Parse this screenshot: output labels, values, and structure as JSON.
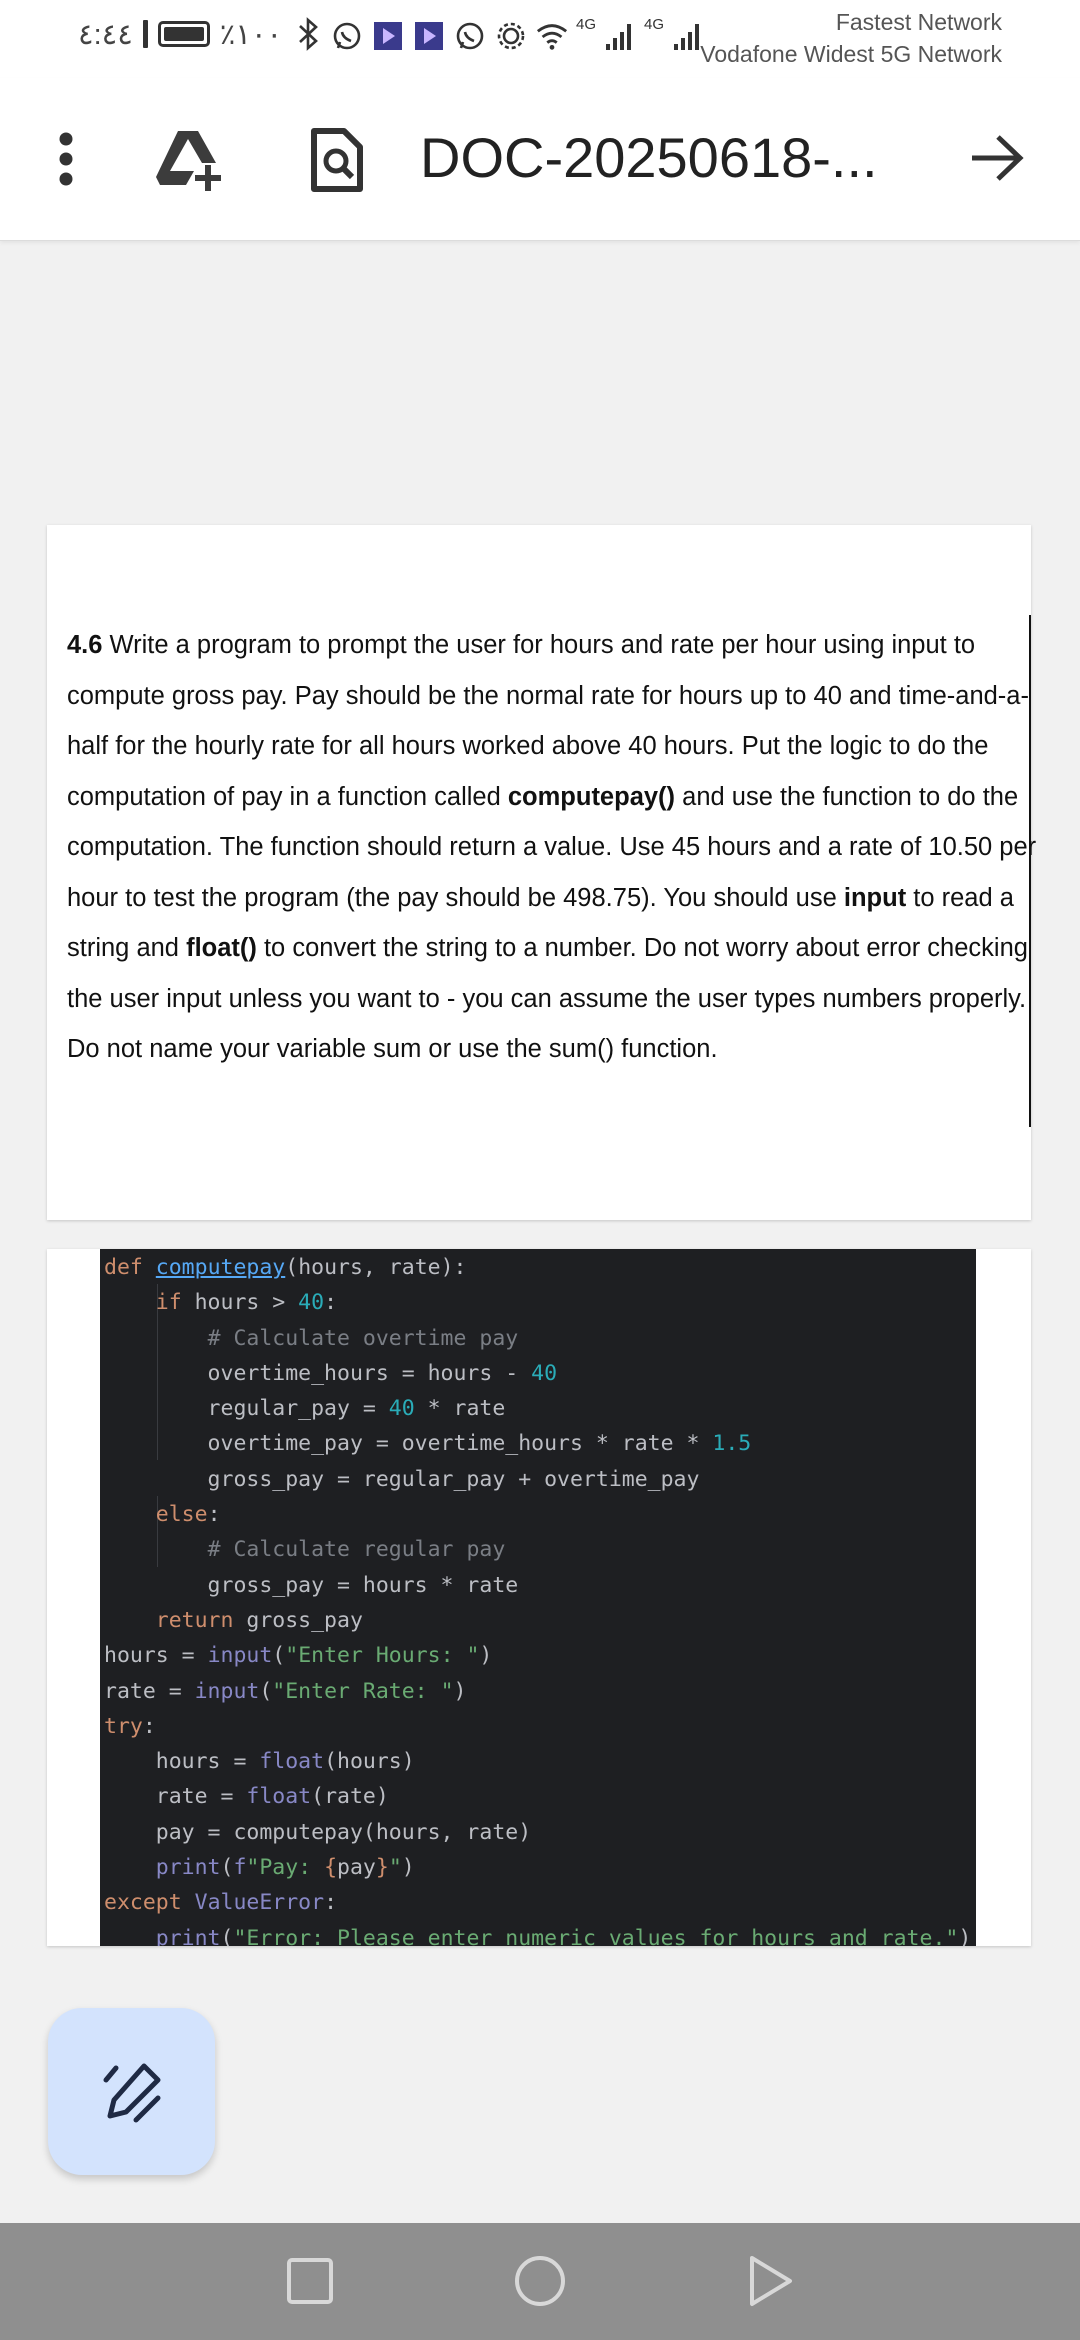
{
  "status_bar": {
    "time": "٤:٤٤",
    "battery_percent": "٪١٠٠",
    "network_line1": "Fastest Network",
    "network_line2": "Vodafone Widest 5G Network",
    "signal_1": "4G",
    "signal_2": "4G",
    "icons": [
      "bluetooth-icon",
      "whatsapp-icon",
      "play-app-icon",
      "play-app-icon",
      "whatsapp-icon",
      "settings-gear-icon",
      "wifi-icon",
      "signal-icon",
      "signal-icon"
    ]
  },
  "app_bar": {
    "title": "DOC-20250618-...",
    "icons": [
      "more-vert-icon",
      "add-to-drive-icon",
      "find-in-page-icon",
      "arrow-forward-icon"
    ]
  },
  "document": {
    "problem": {
      "number": "4.6",
      "text_1": " Write a program to prompt the user for hours and rate per hour using input to compute gross pay. Pay should be the normal rate for hours up to 40 and time-and-a-half for the hourly rate for all hours worked above 40 hours. Put the logic to do the computation of pay in a function called ",
      "bold_1": "computepay()",
      "text_2": " and use the function to do the computation. The function should return a value. Use 45 hours and a rate of 10.50 per hour to test the program (the pay should be 498.75). You should use ",
      "bold_2": "input",
      "text_3": " to read a string and ",
      "bold_3": "float()",
      "text_4": " to convert the string to a number. Do not worry about error checking the user input unless you want to - you can assume the user types numbers properly. Do not name your variable sum or use the sum() function."
    },
    "code_lines": [
      "def computepay(hours, rate):",
      "    if hours > 40:",
      "        # Calculate overtime pay",
      "        overtime_hours = hours - 40",
      "        regular_pay = 40 * rate",
      "        overtime_pay = overtime_hours * rate * 1.5",
      "        gross_pay = regular_pay + overtime_pay",
      "    else:",
      "        # Calculate regular pay",
      "        gross_pay = hours * rate",
      "    return gross_pay",
      "hours = input(\"Enter Hours: \")",
      "rate = input(\"Enter Rate: \")",
      "try:",
      "    hours = float(hours)",
      "    rate = float(rate)",
      "    pay = computepay(hours, rate)",
      "    print(f\"Pay: {pay}\")",
      "except ValueError:",
      "    print(\"Error: Please enter numeric values for hours and rate.\")"
    ]
  },
  "fab": {
    "icon": "edit-pencil-icon"
  },
  "nav_bar": {
    "icons": [
      "recents-square-icon",
      "home-circle-icon",
      "back-triangle-icon"
    ]
  },
  "colors": {
    "code_background": "#1e1f22",
    "keyword": "#cf8e6d",
    "function": "#56a8f5",
    "number": "#2aacb8",
    "string": "#6aab73",
    "comment": "#7a7e85",
    "fab_background": "#d3e3fd",
    "nav_bar": "#8f8f8f"
  }
}
